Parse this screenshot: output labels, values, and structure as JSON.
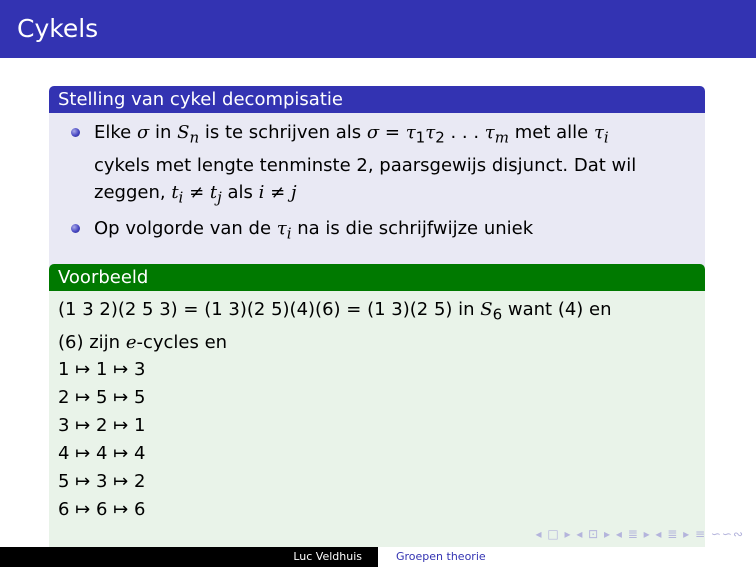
{
  "frame": {
    "title": "Cykels"
  },
  "theorem": {
    "title": "Stelling van cykel decompisatie",
    "item1_line1_a": "Elke ",
    "sigma": "σ",
    "item1_in": " in ",
    "S": "S",
    "n": "n",
    "item1_is": " is te schrijven als ",
    "eq": " = ",
    "tau": "τ",
    "one": "1",
    "two": "2",
    "dots": " . . . ",
    "m": "m",
    "item1_met": " met alle ",
    "i": "i",
    "item1_line2": "cykels met lengte tenminste 2, paarsgewijs disjunct. Dat wil",
    "item1_line3_a": "zeggen, ",
    "t": "t",
    "neq": " ≠ ",
    "j": "j",
    "als": " als ",
    "item2_a": "Op volgorde van de ",
    "item2_b": " na is die schrijfwijze uniek"
  },
  "example": {
    "title": "Voorbeeld",
    "line1_a": "(1 3 2)(2 5 3) = (1 3)(2 5)(4)(6) = (1 3)(2 5) in ",
    "S": "S",
    "six": "6",
    "line1_b": " want (4) en",
    "line2_a": "(6) zijn ",
    "e": "e",
    "line2_b": "-cycles en",
    "mappings": [
      "1 ↦ 1 ↦ 3",
      "2 ↦ 5 ↦ 5",
      "3 ↦ 2 ↦ 1",
      "4 ↦ 4 ↦ 4",
      "5 ↦ 3 ↦ 2",
      "6 ↦ 6 ↦ 6"
    ]
  },
  "footer": {
    "author": "Luc Veldhuis",
    "title": "Groepen theorie",
    "nav_symbols": "◂ □ ▸ ◂ ⊡ ▸ ◂ ≣ ▸ ◂ ≣ ▸ ≡ ∽∽∾"
  }
}
